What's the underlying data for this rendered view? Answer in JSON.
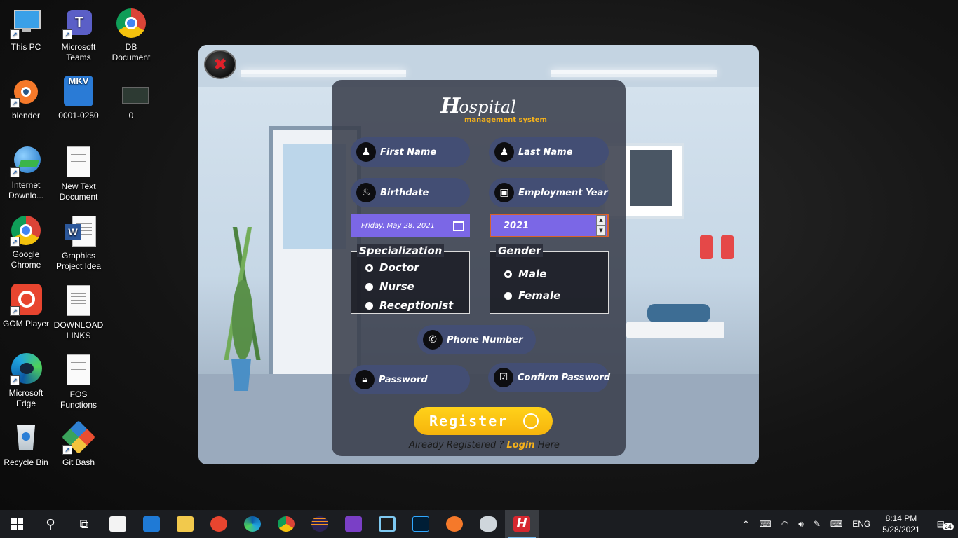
{
  "desktop": {
    "icons": [
      {
        "label": "This PC"
      },
      {
        "label": "Microsoft Teams"
      },
      {
        "label": "DB Document"
      },
      {
        "label": "blender"
      },
      {
        "label": "0001-0250",
        "badge": "MKV"
      },
      {
        "label": "0"
      },
      {
        "label": "Internet Downlo..."
      },
      {
        "label": "New Text Document"
      },
      {
        "label": "Google Chrome"
      },
      {
        "label": "Graphics Project Idea",
        "badge": "W"
      },
      {
        "label": "GOM Player"
      },
      {
        "label": "DOWNLOAD LINKS"
      },
      {
        "label": "Microsoft Edge"
      },
      {
        "label": "FOS Functions"
      },
      {
        "label": "Recycle Bin"
      },
      {
        "label": "Git Bash"
      }
    ]
  },
  "app": {
    "brand_letter": "H",
    "brand_rest": "ospital",
    "brand_sub": "management system",
    "close_glyph": "✖",
    "fields": {
      "first_name": "First Name",
      "last_name": "Last Name",
      "birthdate": "Birthdate",
      "employment_year": "Employment Year",
      "phone": "Phone Number",
      "password": "Password",
      "confirm_password": "Confirm Password"
    },
    "birthdate_value": "Friday, May 28, 2021",
    "employment_year_value": "2021",
    "specialization": {
      "title": "Specialization",
      "options": [
        "Doctor",
        "Nurse",
        "Receptionist"
      ],
      "selected": "Doctor"
    },
    "gender": {
      "title": "Gender",
      "options": [
        "Male",
        "Female"
      ],
      "selected": "Male"
    },
    "register_label": "Register",
    "already_text": "Already Registered ?",
    "login_link": "Login",
    "here_text": "Here"
  },
  "taskbar": {
    "language": "ENG",
    "time": "8:14 PM",
    "date": "5/28/2021",
    "notification_count": "24",
    "app_letter": "H"
  },
  "colors": {
    "accent_purple": "#7b67e6",
    "register_yellow": "#f6b40c",
    "brand_orange": "#f6b21a",
    "field_blue": "#434e74"
  }
}
